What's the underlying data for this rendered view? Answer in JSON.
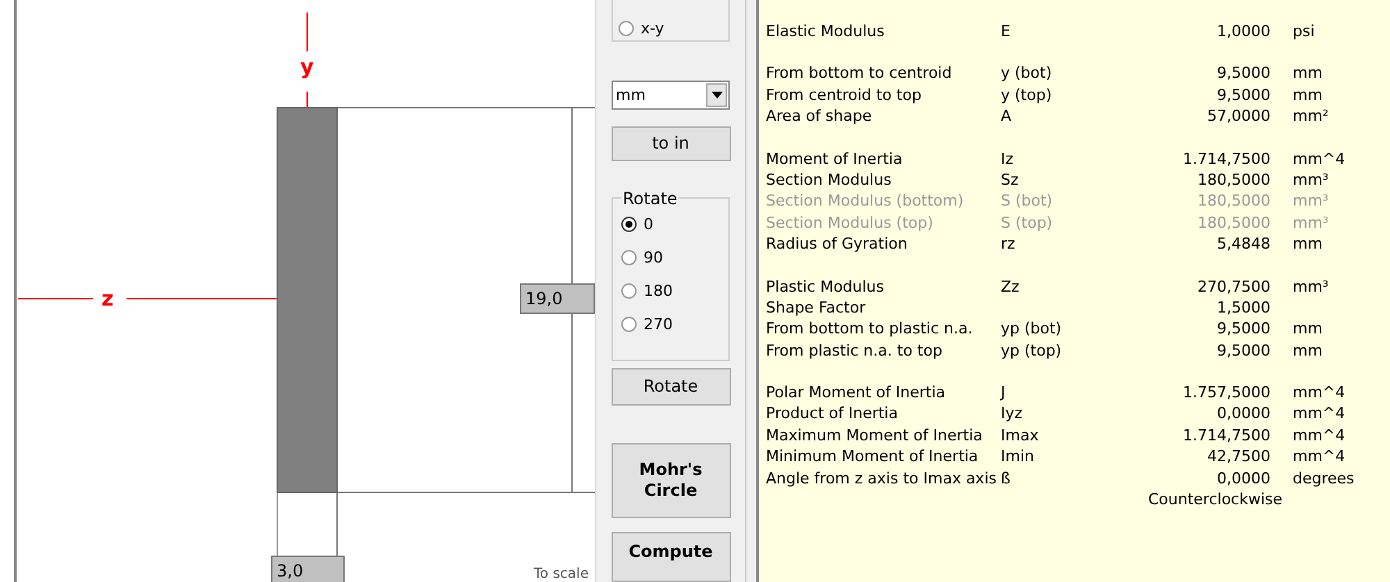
{
  "canvas": {
    "axis_y_label": "y",
    "axis_z_label": "z",
    "height_label": "19,0",
    "width_label": "3,0",
    "scale_note": "To scale"
  },
  "controls": {
    "view_radios": [
      {
        "label": "x-y",
        "selected": false
      }
    ],
    "unit_select": {
      "value": "mm"
    },
    "convert_button": {
      "label": "to in"
    },
    "rotate_group": {
      "title": "Rotate",
      "options": [
        {
          "label": "0",
          "selected": true
        },
        {
          "label": "90",
          "selected": false
        },
        {
          "label": "180",
          "selected": false
        },
        {
          "label": "270",
          "selected": false
        }
      ]
    },
    "buttons": [
      {
        "label": "Rotate",
        "bold": false,
        "kind": "rotate"
      },
      {
        "label": "Mohr's Circle",
        "bold": true,
        "kind": "mohr"
      },
      {
        "label": "Compute",
        "bold": true,
        "kind": "compute"
      }
    ]
  },
  "results": {
    "groups": [
      {
        "rows": [
          {
            "label": "Elastic Modulus",
            "symbol": "E",
            "value": "1,0000",
            "unit": "psi",
            "disabled": false
          }
        ]
      },
      {
        "rows": [
          {
            "label": "From bottom to centroid",
            "symbol": "y (bot)",
            "value": "9,5000",
            "unit": "mm",
            "disabled": false
          },
          {
            "label": "From centroid to top",
            "symbol": "y (top)",
            "value": "9,5000",
            "unit": "mm",
            "disabled": false
          },
          {
            "label": "Area of shape",
            "symbol": "A",
            "value": "57,0000",
            "unit": "mm²",
            "disabled": false
          }
        ]
      },
      {
        "rows": [
          {
            "label": "Moment of Inertia",
            "symbol": "Iz",
            "value": "1.714,7500",
            "unit": "mm^4",
            "disabled": false
          },
          {
            "label": "Section Modulus",
            "symbol": "Sz",
            "value": "180,5000",
            "unit": "mm³",
            "disabled": false
          },
          {
            "label": "Section Modulus (bottom)",
            "symbol": "S (bot)",
            "value": "180,5000",
            "unit": "mm³",
            "disabled": true
          },
          {
            "label": "Section Modulus (top)",
            "symbol": "S (top)",
            "value": "180,5000",
            "unit": "mm³",
            "disabled": true
          },
          {
            "label": "Radius of Gyration",
            "symbol": "rz",
            "value": "5,4848",
            "unit": "mm",
            "disabled": false
          }
        ]
      },
      {
        "rows": [
          {
            "label": "Plastic Modulus",
            "symbol": "Zz",
            "value": "270,7500",
            "unit": "mm³",
            "disabled": false
          },
          {
            "label": "Shape Factor",
            "value": "1,5000",
            "disabled": false
          },
          {
            "label": "From bottom to plastic n.a.",
            "symbol": "yp (bot)",
            "value": "9,5000",
            "unit": "mm",
            "disabled": false
          },
          {
            "label": "From plastic n.a. to top",
            "symbol": "yp (top)",
            "value": "9,5000",
            "unit": "mm",
            "disabled": false
          }
        ]
      },
      {
        "rows": [
          {
            "label": "Polar Moment of Inertia",
            "symbol": "J",
            "value": "1.757,5000",
            "unit": "mm^4",
            "disabled": false
          },
          {
            "label": "Product of Inertia",
            "symbol": "Iyz",
            "value": "0,0000",
            "unit": "mm^4",
            "disabled": false
          },
          {
            "label": "Maximum Moment of Inertia",
            "symbol": "Imax",
            "value": "1.714,7500",
            "unit": "mm^4",
            "disabled": false
          },
          {
            "label": "Minimum Moment of Inertia",
            "symbol": "Imin",
            "value": "42,7500",
            "unit": "mm^4",
            "disabled": false
          },
          {
            "label": "Angle from z axis to Imax axis",
            "symbol": "ß",
            "value": "0,0000",
            "unit": "degrees",
            "disabled": false
          }
        ]
      }
    ],
    "angle_direction": "Counterclockwise"
  }
}
